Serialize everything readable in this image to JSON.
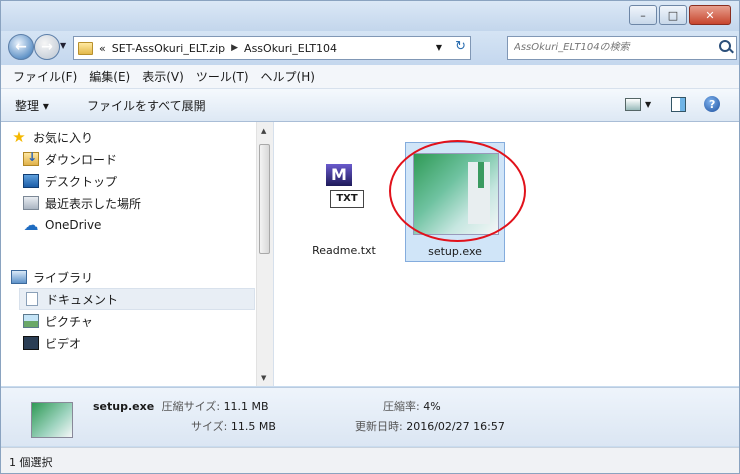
{
  "address": {
    "prefix": "«",
    "crumbs": [
      "SET-AssOkuri_ELT.zip",
      "AssOkuri_ELT104"
    ]
  },
  "search": {
    "placeholder": "AssOkuri_ELT104の検索"
  },
  "menu": [
    "ファイル(F)",
    "編集(E)",
    "表示(V)",
    "ツール(T)",
    "ヘルプ(H)"
  ],
  "toolbar": {
    "organize": "整理 ▾",
    "extract_all": "ファイルをすべて展開"
  },
  "nav": {
    "items": [
      {
        "label": "お気に入り",
        "icon": "star-icon"
      },
      {
        "label": "ダウンロード",
        "icon": "download-icon"
      },
      {
        "label": "デスクトップ",
        "icon": "desktop-icon"
      },
      {
        "label": "最近表示した場所",
        "icon": "recent-places-icon"
      },
      {
        "label": "OneDrive",
        "icon": "onedrive-icon"
      },
      {
        "label": "ライブラリ",
        "icon": "library-icon"
      },
      {
        "label": "ドキュメント",
        "icon": "document-icon"
      },
      {
        "label": "ピクチャ",
        "icon": "pictures-icon"
      },
      {
        "label": "ビデオ",
        "icon": "video-icon"
      }
    ]
  },
  "files": [
    {
      "name": "Readme.txt",
      "icon_text_top": "M",
      "icon_text_bottom": "TXT"
    },
    {
      "name": "setup.exe"
    }
  ],
  "details": {
    "name": "setup.exe",
    "compressed_size_label": "圧縮サイズ:",
    "compressed_size": "11.1 MB",
    "size_label": "サイズ:",
    "size": "11.5 MB",
    "ratio_label": "圧縮率:",
    "ratio": "4%",
    "modified_label": "更新日時:",
    "modified": "2016/02/27 16:57"
  },
  "status": {
    "selection": "1 個選択"
  },
  "colors": {
    "highlight_circle": "#e1121b",
    "selection": "#d0e5f8"
  }
}
